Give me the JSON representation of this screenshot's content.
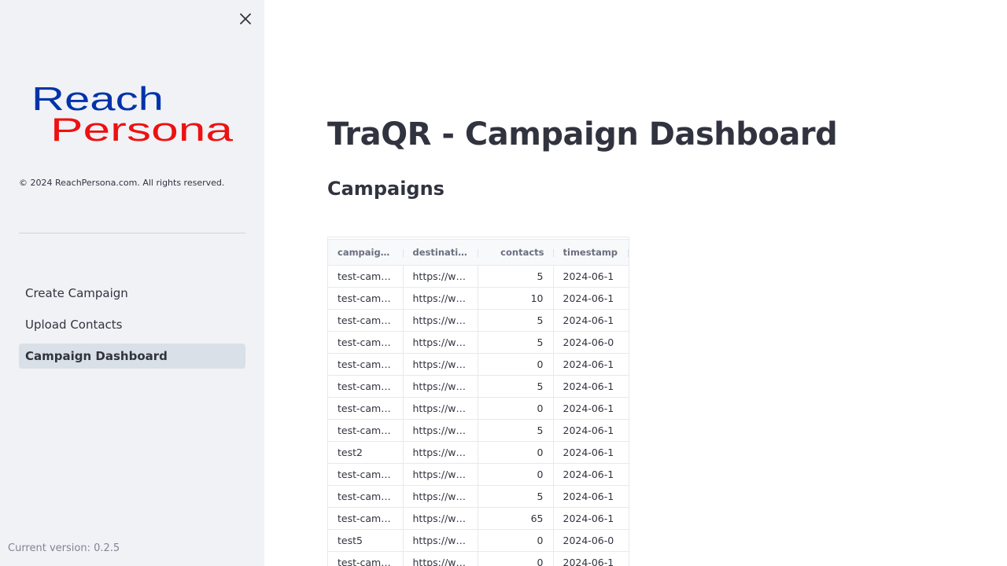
{
  "sidebar": {
    "logo": {
      "line1": "Reach",
      "line2": "Persona",
      "line1_color": "#0033aa",
      "line2_color": "#ee1111"
    },
    "copyright": "© 2024 ReachPersona.com. All rights reserved.",
    "nav": [
      {
        "label": "Create Campaign",
        "active": false
      },
      {
        "label": "Upload Contacts",
        "active": false
      },
      {
        "label": "Campaign Dashboard",
        "active": true
      }
    ],
    "version": "Current version: 0.2.5",
    "close_icon": "close-icon"
  },
  "main": {
    "title": "TraQR - Campaign Dashboard",
    "section": "Campaigns"
  },
  "table": {
    "columns": [
      "campaign_name",
      "destination",
      "contacts",
      "timestamp"
    ],
    "rows": [
      [
        "test-campaign",
        "https://www",
        "5",
        "2024-06-1"
      ],
      [
        "test-campaign",
        "https://www",
        "10",
        "2024-06-1"
      ],
      [
        "test-campaign",
        "https://www",
        "5",
        "2024-06-1"
      ],
      [
        "test-campaign",
        "https://www",
        "5",
        "2024-06-0"
      ],
      [
        "test-campaign",
        "https://www",
        "0",
        "2024-06-1"
      ],
      [
        "test-campaign",
        "https://www",
        "5",
        "2024-06-1"
      ],
      [
        "test-campaign",
        "https://www",
        "0",
        "2024-06-1"
      ],
      [
        "test-campaign",
        "https://www",
        "5",
        "2024-06-1"
      ],
      [
        "test2",
        "https://www",
        "0",
        "2024-06-1"
      ],
      [
        "test-campaign",
        "https://www",
        "0",
        "2024-06-1"
      ],
      [
        "test-campaign",
        "https://www",
        "5",
        "2024-06-1"
      ],
      [
        "test-campaign",
        "https://www",
        "65",
        "2024-06-1"
      ],
      [
        "test5",
        "https://www",
        "0",
        "2024-06-0"
      ],
      [
        "test-campaign",
        "https://www",
        "0",
        "2024-06-1"
      ]
    ]
  }
}
